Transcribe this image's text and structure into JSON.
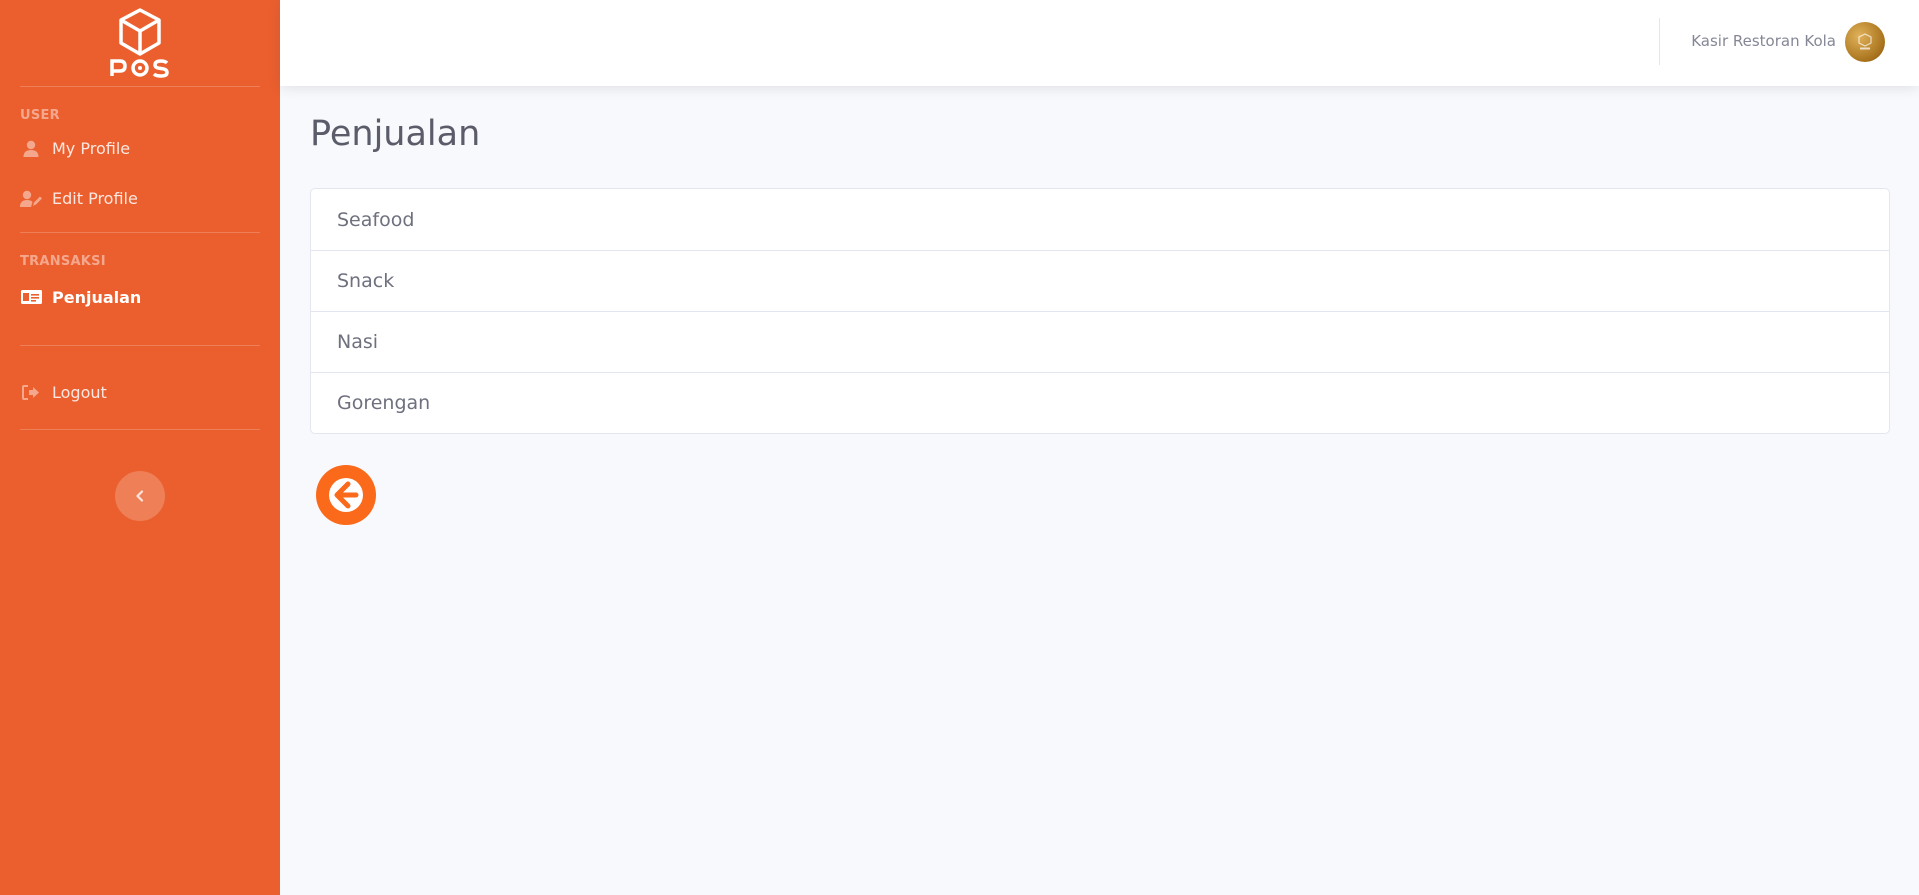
{
  "brand": {
    "logo_text": "POS",
    "logo_icon": "cube-icon"
  },
  "sidebar": {
    "sections": [
      {
        "heading": "USER",
        "items": [
          {
            "label": "My Profile",
            "icon": "user-icon",
            "active": false
          },
          {
            "label": "Edit Profile",
            "icon": "user-edit-icon",
            "active": false
          }
        ]
      },
      {
        "heading": "TRANSAKSI",
        "items": [
          {
            "label": "Penjualan",
            "icon": "money-check-icon",
            "active": true
          }
        ]
      }
    ],
    "logout": {
      "label": "Logout",
      "icon": "sign-out-icon"
    },
    "toggle_icon": "chevron-left-icon"
  },
  "topbar": {
    "user_name": "Kasir Restoran Kola"
  },
  "main": {
    "title": "Penjualan",
    "categories": [
      "Seafood",
      "Snack",
      "Nasi",
      "Gorengan"
    ],
    "back_icon": "arrow-circle-left-icon"
  },
  "colors": {
    "sidebar": "#eb5f2e",
    "accent": "#fa6a1a",
    "background": "#f8f9fc",
    "text": "#5a5c69"
  }
}
